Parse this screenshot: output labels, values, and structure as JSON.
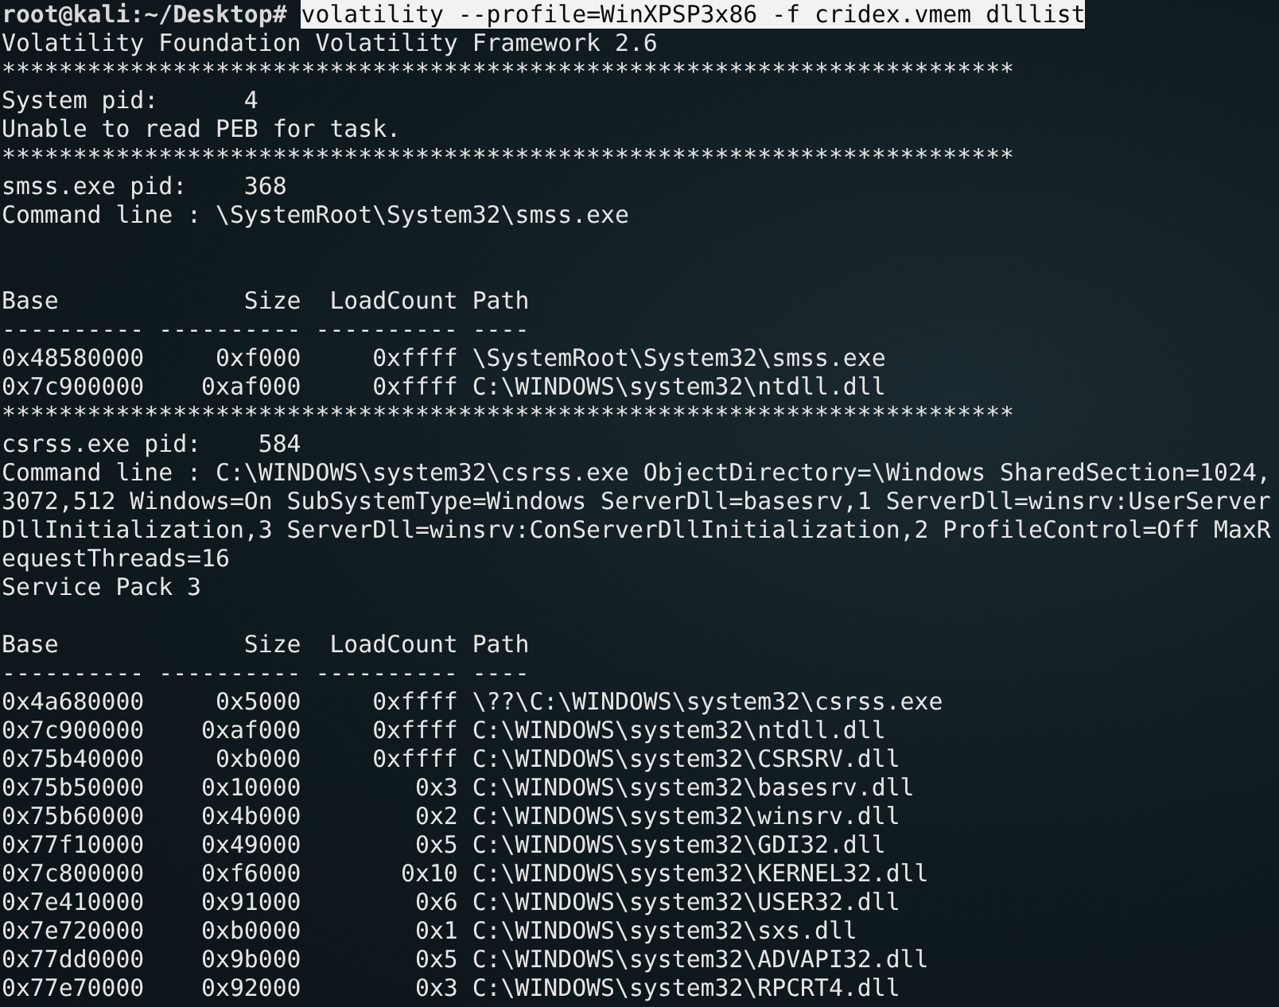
{
  "terminal": {
    "prompt": "root@kali:~/Desktop#",
    "command": {
      "text": "volatility --profile=WinXPSP3x86 -f cridex.vmem dlllist",
      "selected": true
    },
    "lines": [
      {
        "kind": "text",
        "text": "Volatility Foundation Volatility Framework 2.6"
      },
      {
        "kind": "text",
        "text": "***********************************************************************"
      },
      {
        "kind": "text",
        "text": "System pid:      4"
      },
      {
        "kind": "text",
        "text": "Unable to read PEB for task."
      },
      {
        "kind": "text",
        "text": "***********************************************************************"
      },
      {
        "kind": "text",
        "text": "smss.exe pid:    368"
      },
      {
        "kind": "text",
        "text": "Command line : \\SystemRoot\\System32\\smss.exe"
      },
      {
        "kind": "blank"
      },
      {
        "kind": "blank"
      },
      {
        "kind": "text",
        "text": "Base             Size  LoadCount Path"
      },
      {
        "kind": "text",
        "text": "---------- ---------- ---------- ----"
      },
      {
        "kind": "text",
        "text": "0x48580000     0xf000     0xffff \\SystemRoot\\System32\\smss.exe"
      },
      {
        "kind": "text",
        "text": "0x7c900000    0xaf000     0xffff C:\\WINDOWS\\system32\\ntdll.dll"
      },
      {
        "kind": "text",
        "text": "***********************************************************************"
      },
      {
        "kind": "text",
        "text": "csrss.exe pid:    584"
      },
      {
        "kind": "text",
        "text": "Command line : C:\\WINDOWS\\system32\\csrss.exe ObjectDirectory=\\Windows SharedSection=1024,"
      },
      {
        "kind": "text",
        "text": "3072,512 Windows=On SubSystemType=Windows ServerDll=basesrv,1 ServerDll=winsrv:UserServer"
      },
      {
        "kind": "text",
        "text": "DllInitialization,3 ServerDll=winsrv:ConServerDllInitialization,2 ProfileControl=Off MaxR"
      },
      {
        "kind": "text",
        "text": "equestThreads=16"
      },
      {
        "kind": "text",
        "text": "Service Pack 3"
      },
      {
        "kind": "blank"
      },
      {
        "kind": "text",
        "text": "Base             Size  LoadCount Path"
      },
      {
        "kind": "text",
        "text": "---------- ---------- ---------- ----"
      },
      {
        "kind": "text",
        "text": "0x4a680000     0x5000     0xffff \\??\\C:\\WINDOWS\\system32\\csrss.exe"
      },
      {
        "kind": "text",
        "text": "0x7c900000    0xaf000     0xffff C:\\WINDOWS\\system32\\ntdll.dll"
      },
      {
        "kind": "text",
        "text": "0x75b40000     0xb000     0xffff C:\\WINDOWS\\system32\\CSRSRV.dll"
      },
      {
        "kind": "text",
        "text": "0x75b50000    0x10000        0x3 C:\\WINDOWS\\system32\\basesrv.dll"
      },
      {
        "kind": "text",
        "text": "0x75b60000    0x4b000        0x2 C:\\WINDOWS\\system32\\winsrv.dll"
      },
      {
        "kind": "text",
        "text": "0x77f10000    0x49000        0x5 C:\\WINDOWS\\system32\\GDI32.dll"
      },
      {
        "kind": "text",
        "text": "0x7c800000    0xf6000       0x10 C:\\WINDOWS\\system32\\KERNEL32.dll"
      },
      {
        "kind": "text",
        "text": "0x7e410000    0x91000        0x6 C:\\WINDOWS\\system32\\USER32.dll"
      },
      {
        "kind": "text",
        "text": "0x7e720000    0xb0000        0x1 C:\\WINDOWS\\system32\\sxs.dll"
      },
      {
        "kind": "text",
        "text": "0x77dd0000    0x9b000        0x5 C:\\WINDOWS\\system32\\ADVAPI32.dll"
      },
      {
        "kind": "text",
        "text": "0x77e70000    0x92000        0x3 C:\\WINDOWS\\system32\\RPCRT4.dll"
      }
    ]
  }
}
